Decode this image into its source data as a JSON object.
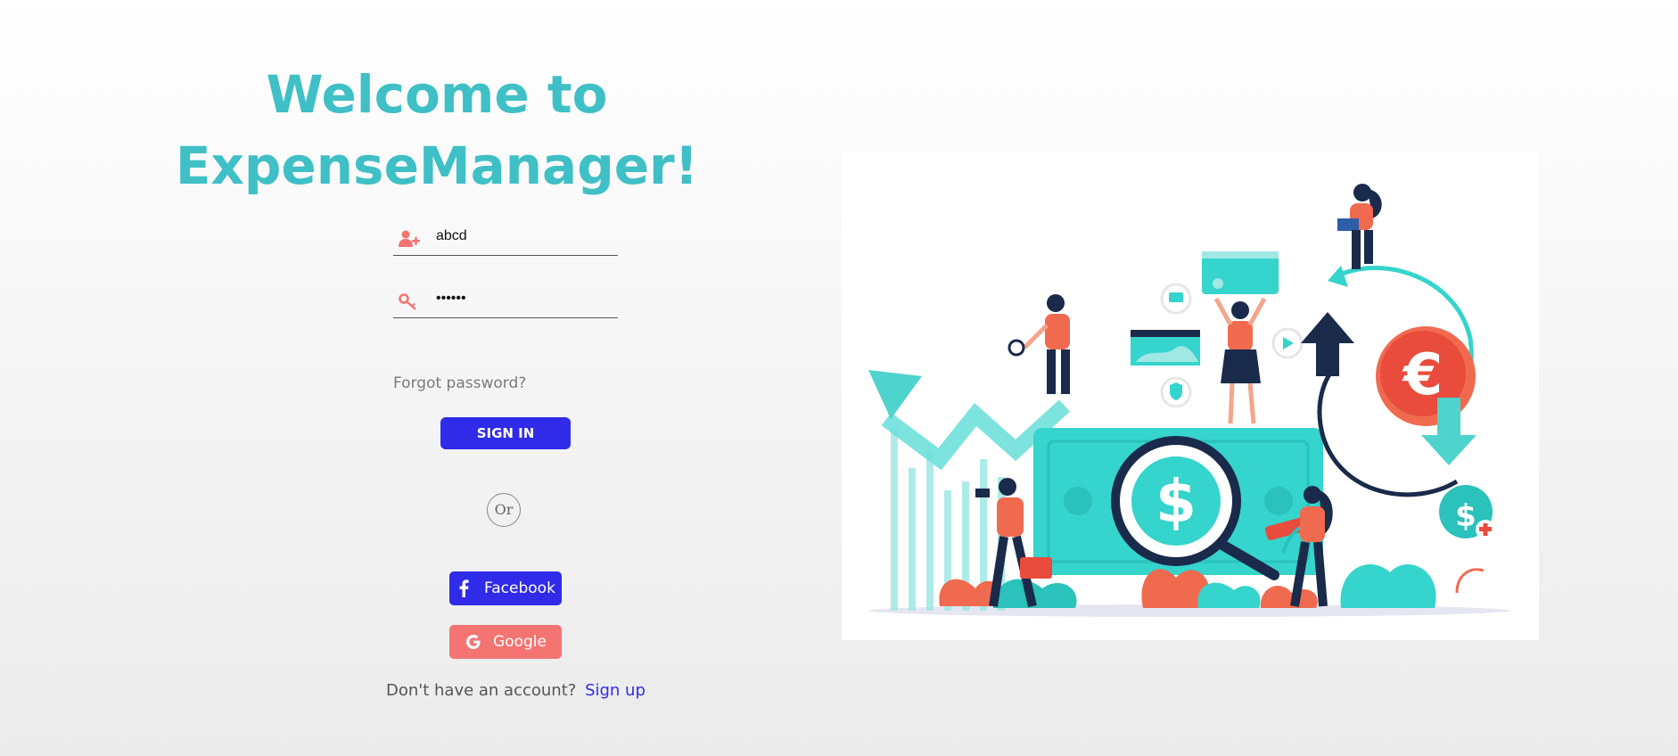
{
  "header": {
    "title_line1": "Welcome to",
    "title_line2": "ExpenseManager!"
  },
  "login_form": {
    "username": {
      "value": "abcd",
      "icon": "user-plus-icon"
    },
    "password": {
      "value": "abcdef",
      "icon": "key-icon"
    },
    "forgot_password_label": "Forgot password?",
    "sign_in_label": "SIGN IN",
    "or_label": "Or"
  },
  "social_login": {
    "facebook_label": "Facebook",
    "google_label": "Google"
  },
  "footer": {
    "no_account_text": "Don't have an account?",
    "sign_up_label": "Sign up"
  },
  "illustration": {
    "currency_symbols": [
      "$",
      "€",
      "$"
    ]
  },
  "colors": {
    "title": "#3fbfc6",
    "primary_button": "#2f2be8",
    "google_button": "#f47472",
    "field_icon": "#f47472",
    "illustration_teal": "#35d4cc",
    "illustration_coral": "#f06a4f",
    "illustration_navy": "#1a2a4a"
  }
}
